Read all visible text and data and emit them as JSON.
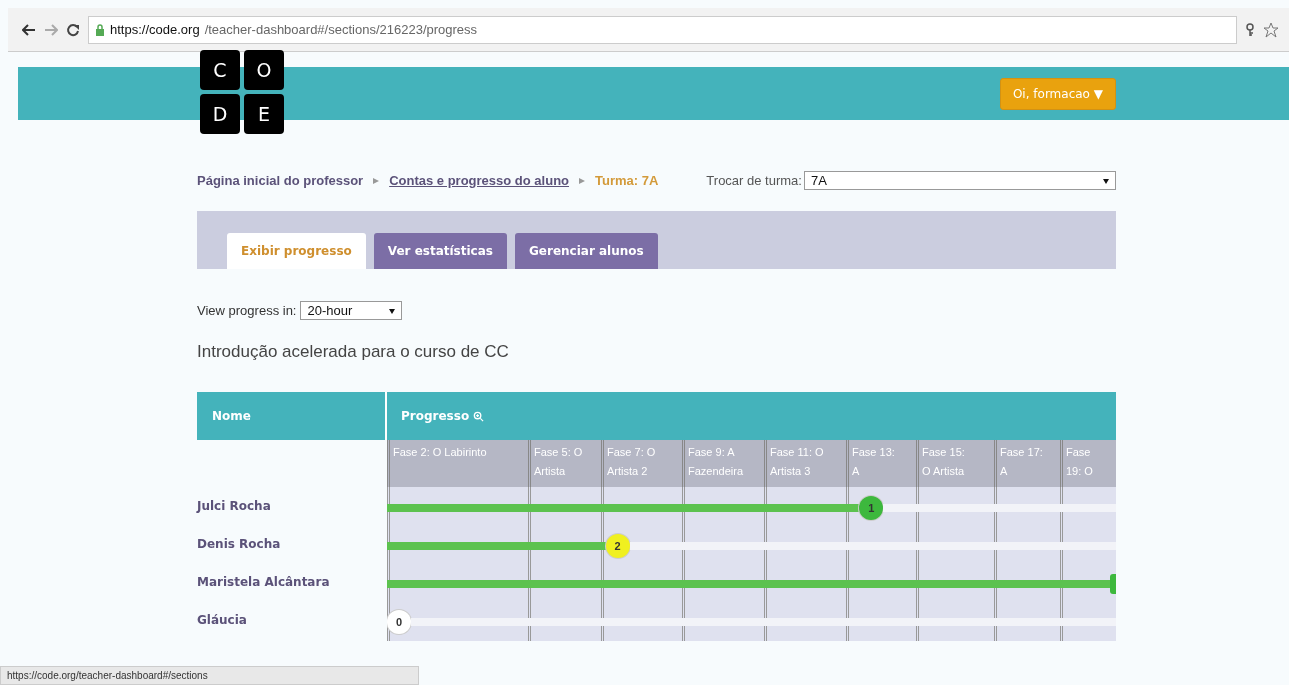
{
  "browser": {
    "url_host": "https://code.org",
    "url_path": "/teacher-dashboard#/sections/216223/progress"
  },
  "header": {
    "logo_letters": [
      "C",
      "O",
      "D",
      "E"
    ],
    "user_button": "Oi, formacao ▼"
  },
  "breadcrumb": [
    {
      "label": "Página inicial do professor",
      "link": false
    },
    {
      "label": "Contas e progresso do aluno",
      "link": true
    },
    {
      "label": "Turma: 7A",
      "link": false
    }
  ],
  "section_switch": {
    "label": "Trocar de turma:",
    "value": "7A"
  },
  "tabs": [
    {
      "label": "Exibir progresso",
      "selected": true
    },
    {
      "label": "Ver estatísticas",
      "selected": false
    },
    {
      "label": "Gerenciar alunos",
      "selected": false
    }
  ],
  "view_progress": {
    "label": "View progress in:",
    "value": "20-hour"
  },
  "course_title": "Introdução acelerada para o curso de CC",
  "table": {
    "name_header": "Nome",
    "progress_header": "Progresso",
    "stages": [
      {
        "lines": [
          "Fase 2: O Labirinto"
        ]
      },
      {
        "lines": [
          "Fase 5: O",
          "Artista"
        ]
      },
      {
        "lines": [
          "Fase 7: O",
          "Artista 2"
        ]
      },
      {
        "lines": [
          "Fase 9: A",
          "Fazendeira"
        ]
      },
      {
        "lines": [
          "Fase 11: O",
          "Artista 3"
        ]
      },
      {
        "lines": [
          "Fase 13:",
          "A"
        ]
      },
      {
        "lines": [
          "Fase 15:",
          "O Artista"
        ]
      },
      {
        "lines": [
          "Fase 17:",
          "A"
        ]
      },
      {
        "lines": [
          "Fase",
          "19: O"
        ]
      }
    ],
    "rows": [
      {
        "name": "Julci Rocha",
        "level": 0.67,
        "marker": "1",
        "color": "#3db83d"
      },
      {
        "name": "Denis Rocha",
        "level": 0.31,
        "marker": "2",
        "color": "#f0f020"
      },
      {
        "name": "Maristela Alcântara",
        "level": 1,
        "color": "#3db83d"
      },
      {
        "name": "Gláucia",
        "level": 0,
        "marker": "0",
        "color": "#ffffff"
      }
    ]
  },
  "status_url": "https://code.org/teacher-dashboard#/sections"
}
